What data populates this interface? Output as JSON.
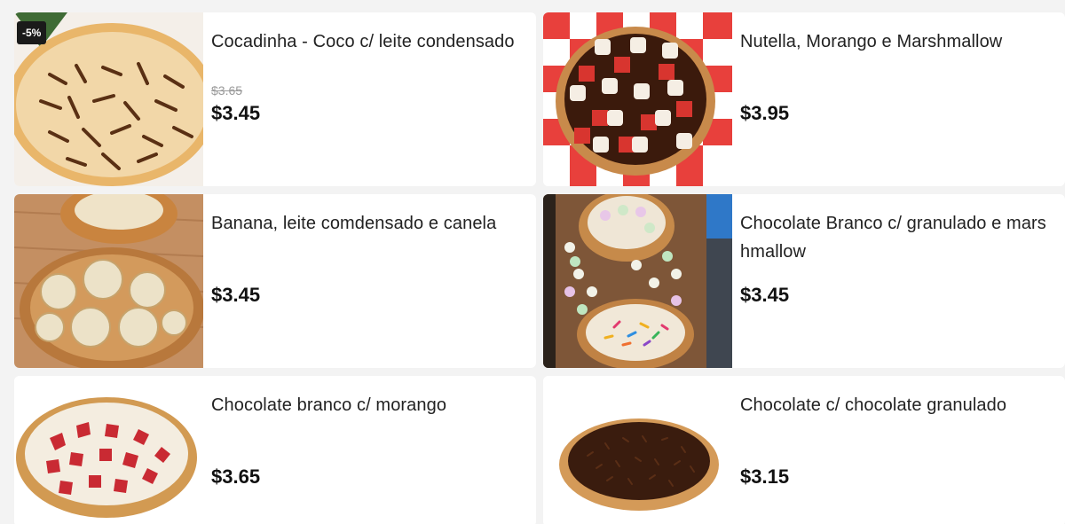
{
  "products": [
    {
      "name": "Cocadinha - Coco c/ leite condensado",
      "old_price": "$3.65",
      "price": "$3.45",
      "badge": "-5%",
      "image": "coconut-pizza-image"
    },
    {
      "name": "Nutella, Morango e Marshmallow",
      "price": "$3.95",
      "image": "nutella-strawberry-marshmallow-pizza-image"
    },
    {
      "name": "Banana, leite comdensado e canela",
      "price": "$3.45",
      "image": "banana-cinnamon-pizza-image"
    },
    {
      "name": "Chocolate Branco c/ granulado e marshmallow",
      "price": "$3.45",
      "image": "white-chocolate-sprinkles-pizza-image"
    },
    {
      "name": "Chocolate branco c/ morango",
      "price": "$3.65",
      "image": "white-chocolate-strawberry-pizza-image"
    },
    {
      "name": "Chocolate c/ chocolate granulado",
      "price": "$3.15",
      "image": "chocolate-sprinkles-pizza-image"
    }
  ]
}
